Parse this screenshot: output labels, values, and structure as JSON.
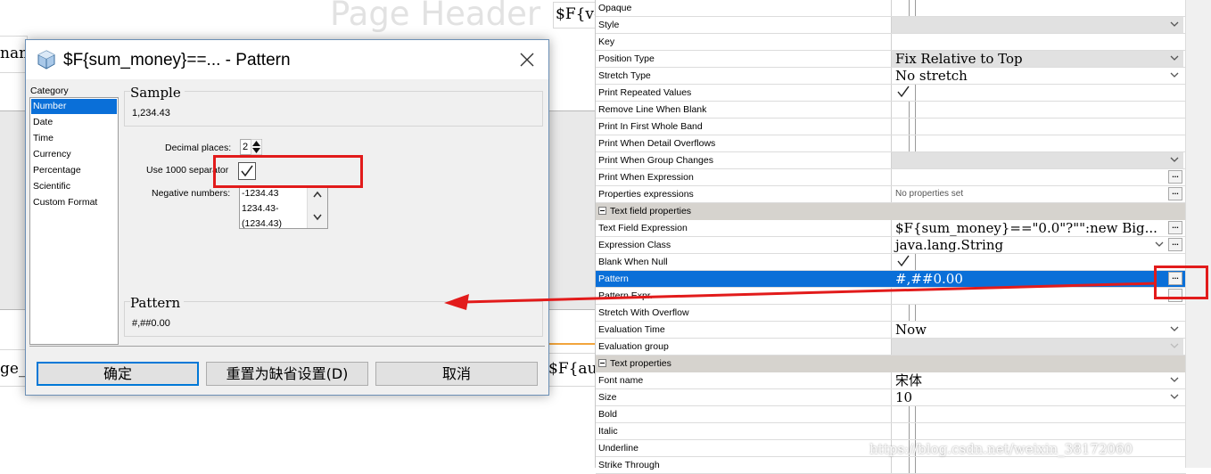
{
  "designer": {
    "header_title": "Page Header",
    "field_top": "$F{vo",
    "field_left_top": "nam",
    "field_left_bottom": "ge_",
    "field_bottom": "$F{aud"
  },
  "dialog": {
    "title": "$F{sum_money}==... - Pattern",
    "category_label": "Category",
    "categories": [
      "Number",
      "Date",
      "Time",
      "Currency",
      "Percentage",
      "Scientific",
      "Custom Format"
    ],
    "selected_category": "Number",
    "sample_title": "Sample",
    "sample_value": "1,234.43",
    "decimal_label": "Decimal places:",
    "decimal_value": "2",
    "separator_label": "Use 1000 separator",
    "separator_checked": true,
    "negative_label": "Negative numbers:",
    "negative_options": [
      "-1234.43",
      "1234.43-",
      "(1234.43)"
    ],
    "pattern_title": "Pattern",
    "pattern_value": "#,##0.00",
    "buttons": {
      "ok": "确定",
      "reset": "重置为缺省设置(D)",
      "cancel": "取消"
    }
  },
  "properties": {
    "rows": {
      "opaque": "Opaque",
      "style": "Style",
      "key": "Key",
      "position_type": "Position Type",
      "position_type_value": "Fix Relative to Top",
      "stretch_type": "Stretch Type",
      "stretch_type_value": "No stretch",
      "print_repeated": "Print Repeated Values",
      "remove_line": "Remove Line When Blank",
      "print_first_band": "Print In First Whole Band",
      "print_detail_overflows": "Print When Detail Overflows",
      "print_group_changes": "Print When Group Changes",
      "print_when_expression": "Print When Expression",
      "properties_expressions": "Properties expressions",
      "properties_expressions_value": "No properties set",
      "text_field_section": "Text field properties",
      "text_field_expression": "Text Field Expression",
      "text_field_expression_value": "$F{sum_money}==\"0.0\"?\"\":new Big...",
      "expression_class": "Expression Class",
      "expression_class_value": "java.lang.String",
      "blank_when_null": "Blank When Null",
      "pattern": "Pattern",
      "pattern_value": "#,##0.00",
      "pattern_expr": "Pattern Expr.",
      "stretch_overflow": "Stretch With Overflow",
      "evaluation_time": "Evaluation Time",
      "evaluation_time_value": "Now",
      "evaluation_group": "Evaluation group",
      "text_section": "Text properties",
      "font_name": "Font name",
      "font_name_value": "宋体",
      "size": "Size",
      "size_value": "10",
      "bold": "Bold",
      "italic": "Italic",
      "underline": "Underline",
      "strike_through": "Strike Through"
    }
  },
  "watermark": "https://blog.csdn.net/weixin_38172060",
  "colors": {
    "selection": "#0a6fd8",
    "annotation": "#e21b1b"
  }
}
